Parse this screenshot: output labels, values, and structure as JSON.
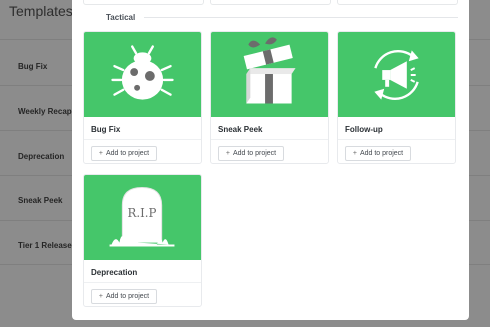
{
  "background": {
    "title": "Templates",
    "items": [
      "Bug Fix",
      "Weekly Recap",
      "Deprecation",
      "Sneak Peek",
      "Tier 1 Release"
    ]
  },
  "modal": {
    "section_label": "Tactical",
    "templates": [
      {
        "title": "Bug Fix",
        "icon": "bug-icon",
        "button": "Add to project"
      },
      {
        "title": "Sneak Peek",
        "icon": "gift-box-icon",
        "button": "Add to project"
      },
      {
        "title": "Follow-up",
        "icon": "megaphone-refresh-icon",
        "button": "Add to project"
      },
      {
        "title": "Deprecation",
        "icon": "tombstone-icon",
        "button": "Add to project",
        "tombstone_text": "R.I.P"
      }
    ]
  },
  "colors": {
    "thumb_green": "#45c66a",
    "overlay": "#8c8c8c",
    "modal_bg": "#ffffff"
  }
}
